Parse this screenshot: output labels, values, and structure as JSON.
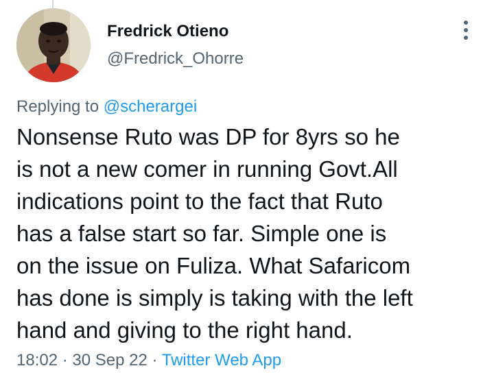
{
  "author": {
    "display_name": "Fredrick Otieno",
    "handle": "@Fredrick_Ohorre",
    "avatar_icon": "profile-photo"
  },
  "reply": {
    "prefix": "Replying to",
    "mention": "@scherargei"
  },
  "tweet": {
    "lines": [
      "Nonsense Ruto was DP for 8yrs so he",
      "is not a new comer in running Govt.All",
      "indications point to the fact that Ruto",
      "has a false start so far. Simple one is",
      "on the issue on Fuliza. What Safaricom",
      "has done is simply is taking with the left",
      "hand and giving to the right hand."
    ]
  },
  "meta": {
    "time": "18:02",
    "separator": "·",
    "date": "30 Sep 22",
    "source": "Twitter Web App"
  },
  "menu": {
    "icon": "more-vertical-icon"
  },
  "colors": {
    "link": "#1d9bf0",
    "secondary_text": "#536471",
    "primary_text": "#0f1419"
  }
}
